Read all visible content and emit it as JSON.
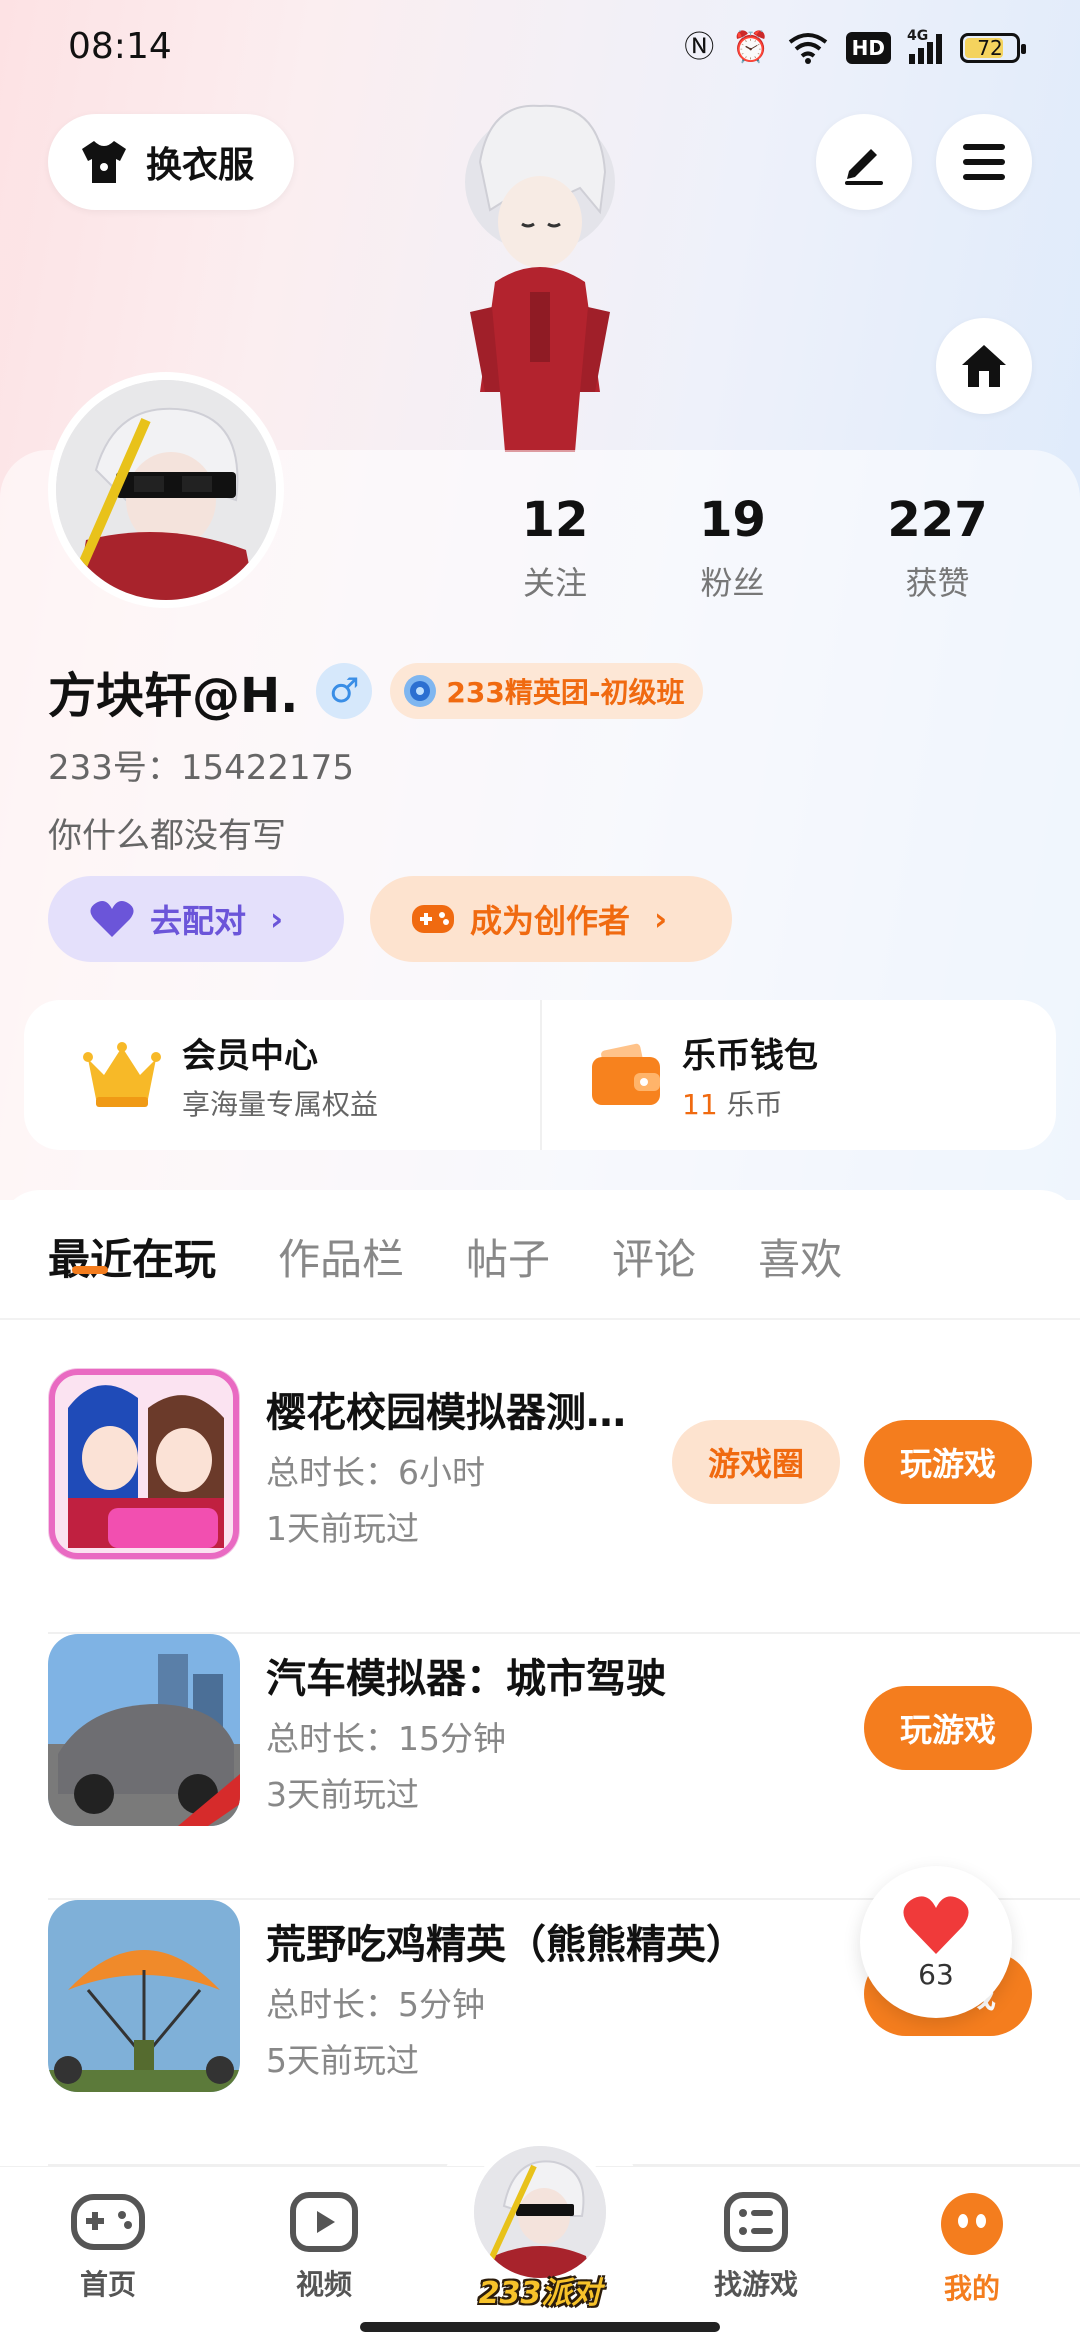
{
  "status_bar": {
    "time": "08:14",
    "battery": "72",
    "network": "4G",
    "hd": "HD"
  },
  "header": {
    "change_clothes": "换衣服"
  },
  "profile": {
    "stats": [
      {
        "value": "12",
        "label": "关注"
      },
      {
        "value": "19",
        "label": "粉丝"
      },
      {
        "value": "227",
        "label": "获赞"
      }
    ],
    "username": "方块轩@H.",
    "gender_symbol": "♂",
    "badge": "233精英团-初级班",
    "uid": "233号：15422175",
    "bio": "你什么都没有写",
    "match_button": "去配对",
    "creator_button": "成为创作者"
  },
  "quick": {
    "vip_title": "会员中心",
    "vip_sub": "享海量专属权益",
    "wallet_title": "乐币钱包",
    "wallet_amount": "11",
    "wallet_unit": "乐币"
  },
  "tabs": [
    "最近在玩",
    "作品栏",
    "帖子",
    "评论",
    "喜欢"
  ],
  "games": [
    {
      "name": "樱花校园模拟器测…",
      "duration": "总时长：6小时",
      "last_played": "1天前玩过",
      "circle_button": "游戏圈",
      "play_button": "玩游戏"
    },
    {
      "name": "汽车模拟器：城市驾驶",
      "duration": "总时长：15分钟",
      "last_played": "3天前玩过",
      "play_button": "玩游戏"
    },
    {
      "name": "荒野吃鸡精英（熊熊精英）",
      "duration": "总时长：5分钟",
      "last_played": "5天前玩过",
      "play_button": "玩游戏"
    }
  ],
  "floating_like": {
    "count": "63"
  },
  "nav": {
    "home": "首页",
    "video": "视频",
    "party": "233派对",
    "find_game": "找游戏",
    "mine": "我的"
  },
  "colors": {
    "accent": "#f47d1e",
    "purple": "#6b55d9"
  }
}
